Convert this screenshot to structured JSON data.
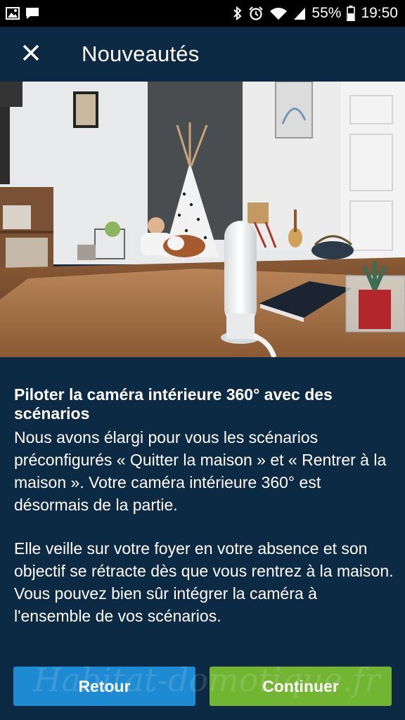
{
  "status_bar": {
    "battery_percent": "55%",
    "time": "19:50",
    "icons_left": [
      "image-icon",
      "message-icon"
    ],
    "icons_right": [
      "bluetooth-icon",
      "alarm-icon",
      "wifi-icon",
      "signal-icon",
      "battery-icon"
    ]
  },
  "appbar": {
    "close_icon": "close-icon",
    "title": "Nouveautés"
  },
  "content": {
    "heading": "Piloter la caméra intérieure 360° avec des scénarios",
    "paragraph1": "Nous avons élargi pour vous les scénarios préconfigurés « Quitter la maison » et « Rentrer à la maison ». Votre caméra intérieure 360° est désormais de la partie.",
    "paragraph2": "Elle veille sur votre foyer en votre absence et son objectif se rétracte dès que vous rentrez à la maison. Vous pouvez bien sûr intégrer la caméra à l'ensemble de vos scénarios."
  },
  "buttons": {
    "back_label": "Retour",
    "continue_label": "Continuer"
  },
  "watermark": "Habitat-domotique.fr",
  "colors": {
    "background": "#0d2a45",
    "back_button": "#1e8ad1",
    "continue_button": "#72b533"
  }
}
